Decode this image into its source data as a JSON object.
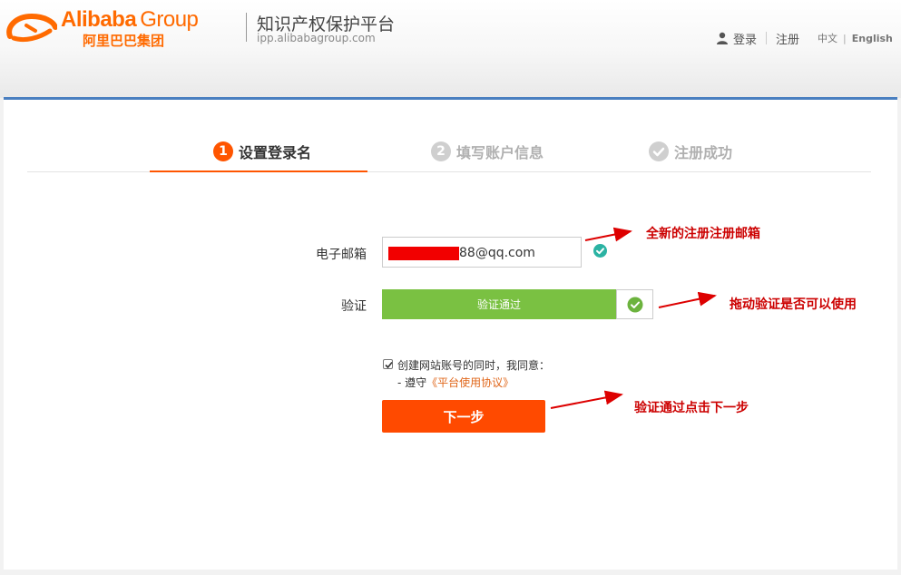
{
  "header": {
    "logo_en": "Alibaba",
    "logo_group": "Group",
    "logo_cn": "阿里巴巴集团",
    "site_title": "知识产权保护平台",
    "site_url": "ipp.alibabagroup.com",
    "nav": {
      "login": "登录",
      "register": "注册",
      "lang_cn": "中文",
      "lang_sep": "|",
      "lang_en": "English"
    }
  },
  "steps": [
    {
      "num": "1",
      "label": "设置登录名",
      "state": "active"
    },
    {
      "num": "2",
      "label": "填写账户信息",
      "state": "pending"
    },
    {
      "label": "注册成功",
      "state": "pending",
      "icon": "check-circle-icon"
    }
  ],
  "form": {
    "email_label": "电子邮箱",
    "email_value_visible": "88@qq.com",
    "verify_label": "验证",
    "verify_text": "验证通过",
    "agree_text": "创建网站账号的同时，我同意：",
    "agree_line2_prefix": "- 遵守",
    "agree_link": "《平台使用协议》",
    "agree_checked": true,
    "next_button": "下一步"
  },
  "annotations": {
    "email_note": "全新的注册注册邮箱",
    "verify_note": "拖动验证是否可以使用",
    "next_note": "验证通过点击下一步"
  },
  "colors": {
    "brand_orange": "#ff6a00",
    "active_step": "#ff5500",
    "verify_green": "#7ac142",
    "next_button": "#ff4a00",
    "annotation_red": "#cc0000",
    "header_accent_blue": "#4a7fc0"
  }
}
